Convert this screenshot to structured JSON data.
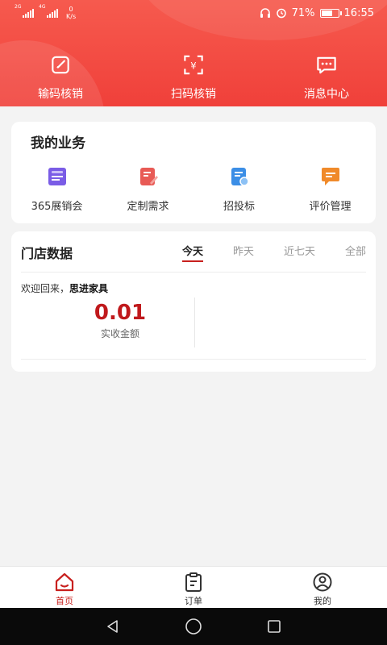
{
  "status_bar": {
    "signal1_tag": "2G",
    "signal2_tag": "4G",
    "speed_value": "0",
    "speed_unit": "K/s",
    "battery": "71%",
    "battery_level": 0.71,
    "time": "16:55"
  },
  "top_actions": [
    {
      "label": "输码核销",
      "icon": "edit-icon"
    },
    {
      "label": "扫码核销",
      "icon": "scan-icon"
    },
    {
      "label": "消息中心",
      "icon": "message-icon"
    }
  ],
  "business": {
    "title": "我的业务",
    "items": [
      {
        "label": "365展销会",
        "icon": "expo-icon",
        "color": "#7a5ce6"
      },
      {
        "label": "定制需求",
        "icon": "custom-icon",
        "color": "#e85a55"
      },
      {
        "label": "招投标",
        "icon": "bidding-icon",
        "color": "#3b8ee6"
      },
      {
        "label": "评价管理",
        "icon": "review-icon",
        "color": "#f08a2a"
      }
    ]
  },
  "store": {
    "title": "门店数据",
    "tabs": [
      {
        "label": "今天",
        "active": true
      },
      {
        "label": "昨天",
        "active": false
      },
      {
        "label": "近七天",
        "active": false
      },
      {
        "label": "全部",
        "active": false
      }
    ],
    "welcome_prefix": "欢迎回来，",
    "store_name": "思进家具",
    "metric_value": "0.01",
    "metric_label": "实收金额"
  },
  "bottom_nav": [
    {
      "label": "首页",
      "icon": "home-icon",
      "active": true
    },
    {
      "label": "订单",
      "icon": "order-icon",
      "active": false
    },
    {
      "label": "我的",
      "icon": "profile-icon",
      "active": false
    }
  ],
  "colors": {
    "brand": "#f04a40",
    "accent": "#c8201e",
    "metric": "#c0191c"
  }
}
